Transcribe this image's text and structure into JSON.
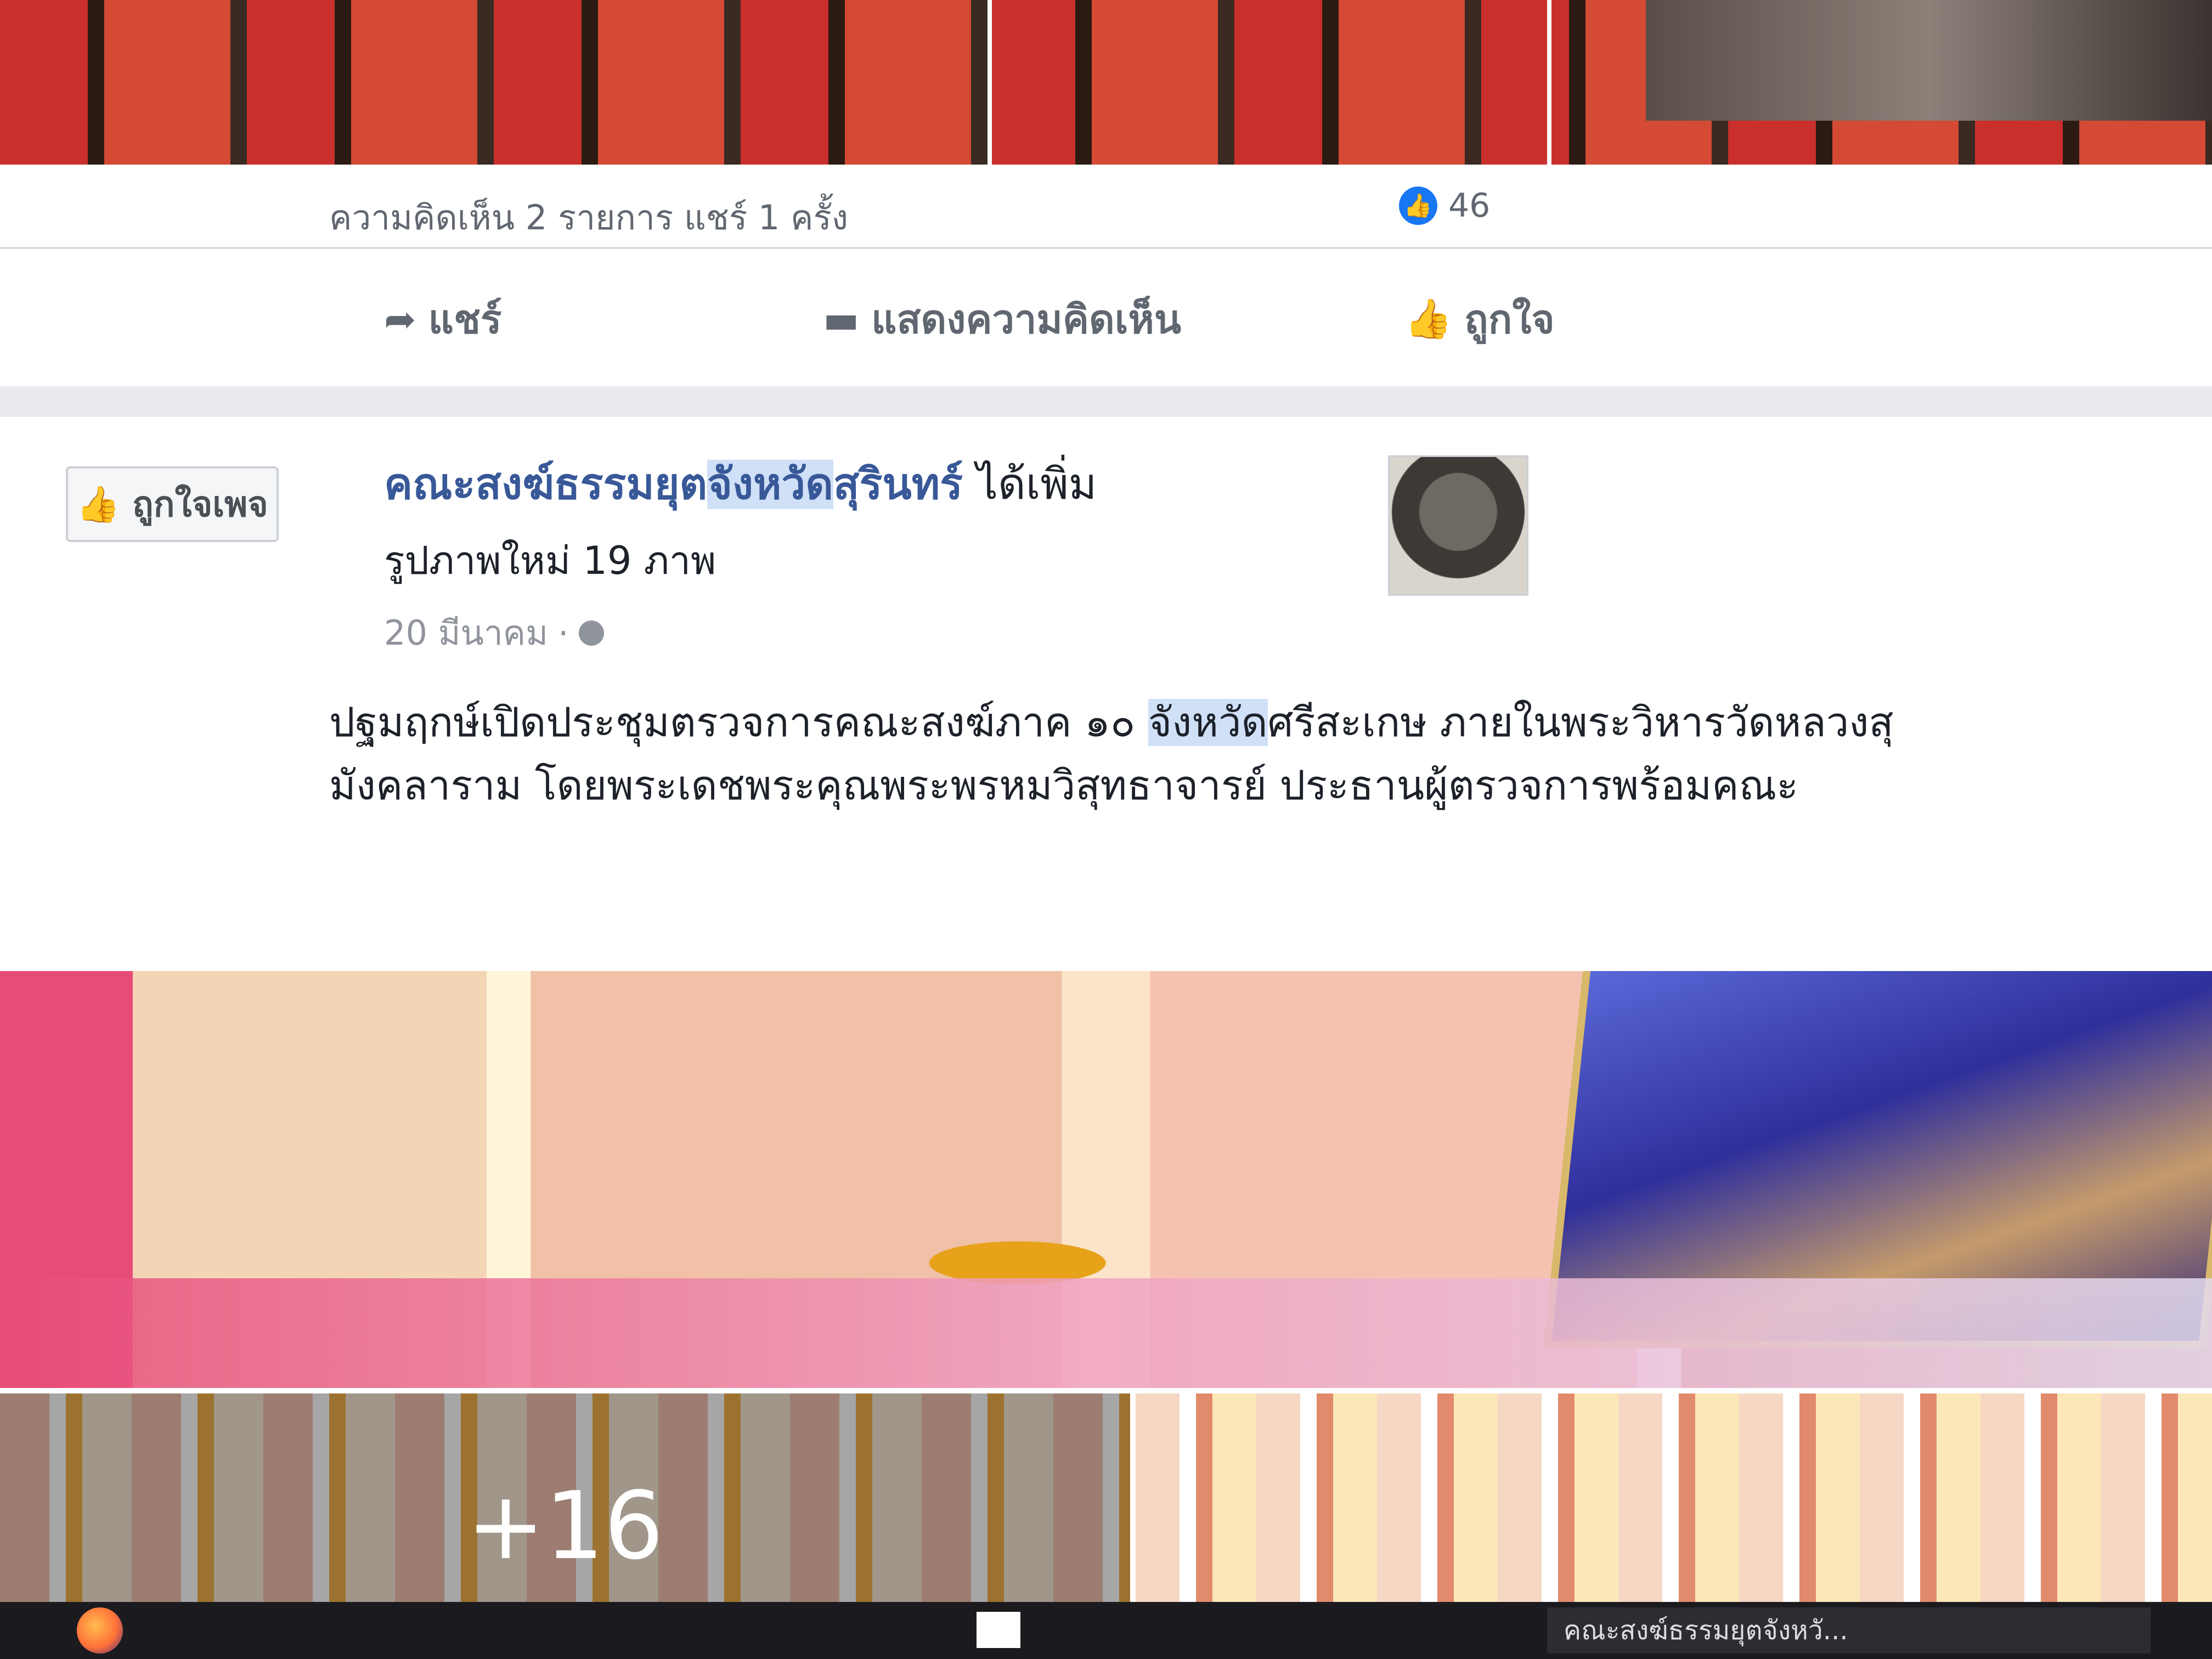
{
  "previous_post": {
    "reaction_count": "46",
    "comment_share_summary": "ความคิดเห็น 2 รายการ  แชร์ 1 ครั้ง",
    "actions": {
      "like": "ถูกใจ",
      "comment": "แสดงความคิดเห็น",
      "share": "แชร์"
    }
  },
  "post": {
    "page_name_part1": "คณะสงฆ์ธรรมยุต",
    "page_name_highlight": "จังหวัด",
    "page_name_part2": "สุรินทร์",
    "added_text": " ได้เพิ่ม",
    "album_text": "รูปภาพใหม่ 19 ภาพ",
    "date": "20 มีนาคม",
    "page_like_button": "ถูกใจเพจ",
    "body_part1": "ปฐมฤกษ์เปิดประชุมตรวจการคณะสงฆ์ภาค ๑๐ ",
    "body_highlight": "จังหวัด",
    "body_part2": "ศรีสะเกษ ภายในพระวิหารวัดหลวงสุมังคลาราม โดยพระเดชพระคุณพระพรหมวิสุทธาจารย์ ประธานผู้ตรวจการพร้อมคณะ",
    "more_photos": "+16"
  },
  "taskbar": {
    "app_label": "คณะสงฆ์ธรรมยุตจังหวั..."
  },
  "icons": {
    "like": "thumbs-up-icon",
    "comment": "comment-icon",
    "share": "share-arrow-icon",
    "globe": "globe-icon"
  },
  "colors": {
    "link": "#385898",
    "highlight": "#cfe0f7",
    "like_blue": "#1877f2"
  }
}
